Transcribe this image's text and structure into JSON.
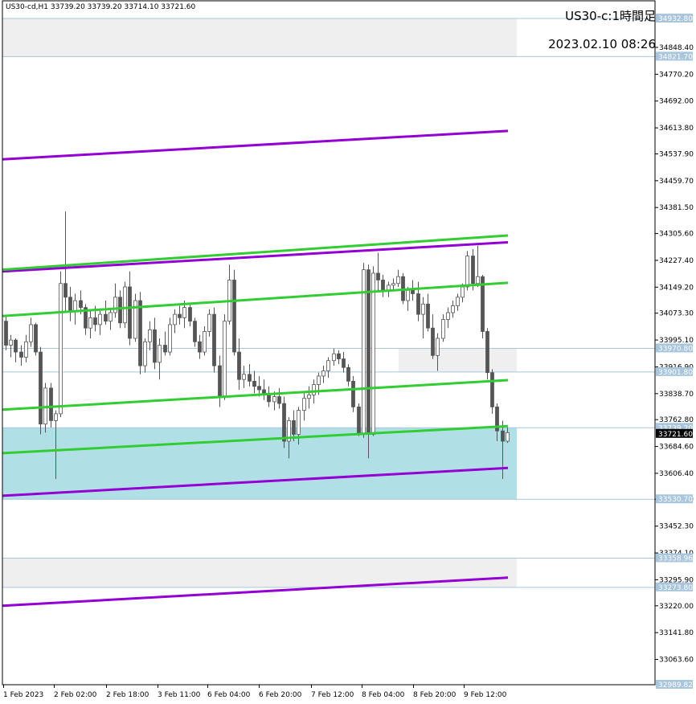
{
  "header": {
    "ohlc_text": "US30-cd,H1  33739.20 33739.20 33714.10 33721.60",
    "symbol_label": "US30-c:1時間足",
    "datetime_label": "2023.02.10 08:26"
  },
  "chart_data": {
    "type": "candlestick",
    "symbol": "US30-cd",
    "timeframe": "H1",
    "ylim": [
      32989.82,
      34932.8
    ],
    "y_ticks": [
      "34848.40",
      "34770.20",
      "34692.00",
      "34613.80",
      "34537.90",
      "34459.70",
      "34381.50",
      "34305.60",
      "34227.40",
      "34149.20",
      "34073.30",
      "33995.10",
      "33916.90",
      "33838.70",
      "33762.80",
      "33684.60",
      "33606.40",
      "33530.70",
      "33452.30",
      "33374.10",
      "33295.90",
      "33220.00",
      "33141.80",
      "33063.60"
    ],
    "x_ticks": [
      "1 Feb 2023",
      "2 Feb 02:00",
      "2 Feb 18:00",
      "3 Feb 11:00",
      "6 Feb 04:00",
      "6 Feb 20:00",
      "7 Feb 12:00",
      "8 Feb 04:00",
      "8 Feb 20:00",
      "9 Feb 12:00"
    ],
    "price_labels": [
      {
        "value": 34932.8,
        "text": "34932.80",
        "kind": "level"
      },
      {
        "value": 34821.7,
        "text": "34821.70",
        "kind": "level"
      },
      {
        "value": 33970.8,
        "text": "33970.80",
        "kind": "level"
      },
      {
        "value": 33901.8,
        "text": "33901.80",
        "kind": "level"
      },
      {
        "value": 33739.2,
        "text": "33739.20",
        "kind": "level"
      },
      {
        "value": 33721.6,
        "text": "33721.60",
        "kind": "current"
      },
      {
        "value": 33530.7,
        "text": "33530.70",
        "kind": "level"
      },
      {
        "value": 33358.96,
        "text": "33358.96",
        "kind": "level"
      },
      {
        "value": 33273.8,
        "text": "33273.80",
        "kind": "level"
      },
      {
        "value": 32989.82,
        "text": "32989.82",
        "kind": "level"
      }
    ],
    "zones": [
      {
        "from": 34821.7,
        "to": 34932.8,
        "color": "#efefef"
      },
      {
        "from": 33901.8,
        "to": 33970.8,
        "color": "#efefef",
        "start_fraction": 0.77
      },
      {
        "from": 33530.7,
        "to": 33739.2,
        "color": "#b0e0e6"
      },
      {
        "from": 33273.8,
        "to": 33358.96,
        "color": "#efefef"
      }
    ],
    "trend_lines": [
      {
        "color": "#9400d3",
        "from": 34522,
        "to": 34605
      },
      {
        "color": "#9400d3",
        "from": 34195,
        "to": 34280
      },
      {
        "color": "#9400d3",
        "from": 33541,
        "to": 33622
      },
      {
        "color": "#9400d3",
        "from": 33220,
        "to": 33302
      },
      {
        "color": "#32cd32",
        "from": 34200,
        "to": 34300
      },
      {
        "color": "#32cd32",
        "from": 34065,
        "to": 34162
      },
      {
        "color": "#32cd32",
        "from": 33792,
        "to": 33878
      },
      {
        "color": "#32cd32",
        "from": 33665,
        "to": 33744
      }
    ],
    "candles": [
      [
        34050,
        34065,
        33965,
        33980
      ],
      [
        33980,
        34010,
        33945,
        33995
      ],
      [
        33995,
        34000,
        33930,
        33960
      ],
      [
        33960,
        33980,
        33920,
        33945
      ],
      [
        33945,
        34010,
        33930,
        33990
      ],
      [
        33990,
        34060,
        33975,
        34040
      ],
      [
        34040,
        34045,
        33950,
        33960
      ],
      [
        33960,
        33975,
        33720,
        33750
      ],
      [
        33750,
        33870,
        33725,
        33855
      ],
      [
        33855,
        33870,
        33740,
        33760
      ],
      [
        33760,
        33790,
        33590,
        33780
      ],
      [
        33780,
        34195,
        33770,
        34160
      ],
      [
        34160,
        34370,
        34080,
        34120
      ],
      [
        34120,
        34150,
        34050,
        34080
      ],
      [
        34080,
        34130,
        34040,
        34110
      ],
      [
        34110,
        34140,
        34070,
        34090
      ],
      [
        34090,
        34100,
        34010,
        34030
      ],
      [
        34030,
        34080,
        34000,
        34060
      ],
      [
        34060,
        34095,
        34020,
        34040
      ],
      [
        34040,
        34080,
        34010,
        34070
      ],
      [
        34070,
        34110,
        34040,
        34050
      ],
      [
        34050,
        34085,
        34025,
        34075
      ],
      [
        34075,
        34160,
        34060,
        34120
      ],
      [
        34120,
        34140,
        34030,
        34045
      ],
      [
        34045,
        34165,
        34030,
        34150
      ],
      [
        34150,
        34195,
        33980,
        34000
      ],
      [
        34000,
        34130,
        33990,
        34110
      ],
      [
        34110,
        34135,
        33895,
        33920
      ],
      [
        33920,
        34000,
        33900,
        33990
      ],
      [
        33990,
        34050,
        33965,
        34025
      ],
      [
        34025,
        34060,
        33910,
        33930
      ],
      [
        33930,
        34000,
        33880,
        33980
      ],
      [
        33980,
        34020,
        33950,
        33960
      ],
      [
        33960,
        34060,
        33950,
        34040
      ],
      [
        34040,
        34085,
        34015,
        34070
      ],
      [
        34070,
        34095,
        34040,
        34060
      ],
      [
        34060,
        34110,
        34030,
        34090
      ],
      [
        34090,
        34100,
        34035,
        34050
      ],
      [
        34050,
        34060,
        33975,
        33990
      ],
      [
        33990,
        34010,
        33940,
        33960
      ],
      [
        33960,
        34035,
        33950,
        34020
      ],
      [
        34020,
        34085,
        34005,
        34070
      ],
      [
        34070,
        34090,
        33900,
        33920
      ],
      [
        33920,
        33950,
        33800,
        33830
      ],
      [
        33830,
        34070,
        33820,
        34050
      ],
      [
        34050,
        34215,
        34040,
        34170
      ],
      [
        34170,
        34200,
        33950,
        33960
      ],
      [
        33960,
        34000,
        33850,
        33880
      ],
      [
        33880,
        33920,
        33855,
        33895
      ],
      [
        33895,
        33925,
        33860,
        33875
      ],
      [
        33875,
        33905,
        33840,
        33860
      ],
      [
        33860,
        33890,
        33830,
        33850
      ],
      [
        33850,
        33880,
        33820,
        33835
      ],
      [
        33835,
        33860,
        33800,
        33815
      ],
      [
        33815,
        33845,
        33790,
        33830
      ],
      [
        33830,
        33855,
        33795,
        33810
      ],
      [
        33810,
        33830,
        33680,
        33700
      ],
      [
        33700,
        33770,
        33650,
        33760
      ],
      [
        33760,
        33790,
        33700,
        33720
      ],
      [
        33720,
        33800,
        33690,
        33790
      ],
      [
        33790,
        33840,
        33760,
        33825
      ],
      [
        33825,
        33860,
        33795,
        33835
      ],
      [
        33835,
        33880,
        33810,
        33865
      ],
      [
        33865,
        33900,
        33835,
        33890
      ],
      [
        33890,
        33920,
        33870,
        33905
      ],
      [
        33905,
        33945,
        33885,
        33935
      ],
      [
        33935,
        33970,
        33920,
        33955
      ],
      [
        33955,
        33965,
        33925,
        33940
      ],
      [
        33940,
        33960,
        33900,
        33915
      ],
      [
        33915,
        33925,
        33860,
        33875
      ],
      [
        33875,
        33890,
        33785,
        33800
      ],
      [
        33800,
        33810,
        33715,
        33720
      ],
      [
        33720,
        34220,
        33710,
        34200
      ],
      [
        34200,
        34215,
        33650,
        33720
      ],
      [
        33720,
        34210,
        33715,
        34190
      ],
      [
        34190,
        34250,
        34140,
        34170
      ],
      [
        34170,
        34185,
        34120,
        34140
      ],
      [
        34140,
        34165,
        34120,
        34155
      ],
      [
        34155,
        34175,
        34140,
        34160
      ],
      [
        34160,
        34200,
        34150,
        34180
      ],
      [
        34180,
        34190,
        34100,
        34110
      ],
      [
        34110,
        34150,
        34080,
        34140
      ],
      [
        34140,
        34170,
        34110,
        34130
      ],
      [
        34130,
        34165,
        34050,
        34070
      ],
      [
        34070,
        34120,
        34000,
        34100
      ],
      [
        34100,
        34130,
        34020,
        34030
      ],
      [
        34030,
        34070,
        33940,
        33950
      ],
      [
        33950,
        34015,
        33905,
        34000
      ],
      [
        34000,
        34070,
        33990,
        34055
      ],
      [
        34055,
        34090,
        34030,
        34075
      ],
      [
        34075,
        34110,
        34060,
        34095
      ],
      [
        34095,
        34130,
        34080,
        34120
      ],
      [
        34120,
        34160,
        34105,
        34150
      ],
      [
        34150,
        34255,
        34140,
        34240
      ],
      [
        34240,
        34260,
        34140,
        34160
      ],
      [
        34160,
        34270,
        34150,
        34180
      ],
      [
        34180,
        34185,
        34000,
        34020
      ],
      [
        34020,
        34030,
        33880,
        33900
      ],
      [
        33900,
        33910,
        33780,
        33800
      ],
      [
        33800,
        33810,
        33700,
        33730
      ],
      [
        33730,
        33760,
        33590,
        33700
      ],
      [
        33700,
        33740,
        33695,
        33725
      ]
    ]
  }
}
